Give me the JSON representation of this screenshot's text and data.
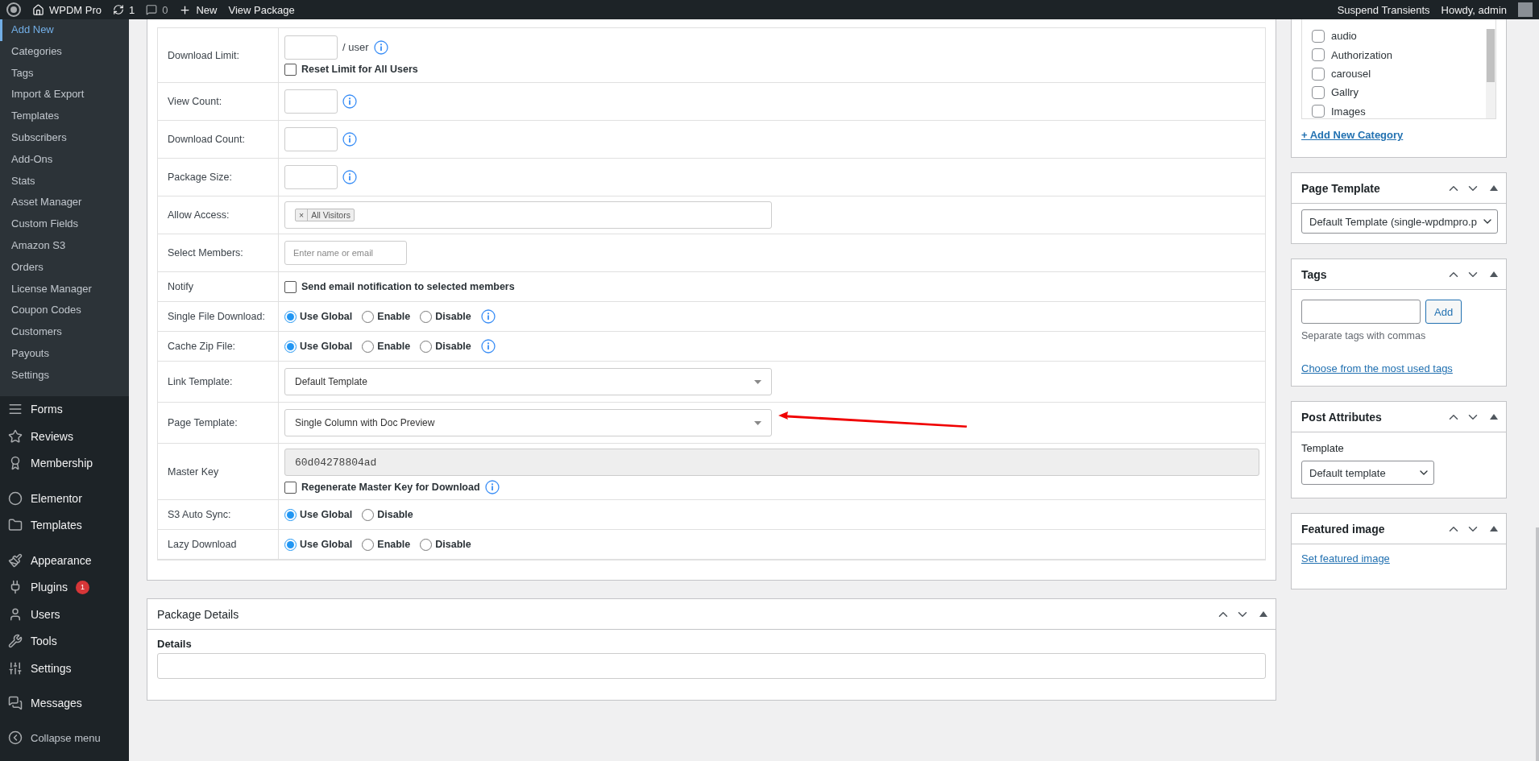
{
  "admin_bar": {
    "site": "WPDM Pro",
    "updates": "1",
    "comments": "0",
    "new": "New",
    "view": "View Package",
    "right": [
      "Suspend Transients",
      "Howdy, admin"
    ]
  },
  "sidebar": {
    "submenu": [
      {
        "label": "Add New",
        "selected": true
      },
      {
        "label": "Categories",
        "selected": false
      },
      {
        "label": "Tags",
        "selected": false
      },
      {
        "label": "Import & Export",
        "selected": false
      },
      {
        "label": "Templates",
        "selected": false
      },
      {
        "label": "Subscribers",
        "selected": false
      },
      {
        "label": "Add-Ons",
        "selected": false
      },
      {
        "label": "Stats",
        "selected": false
      },
      {
        "label": "Asset Manager",
        "selected": false
      },
      {
        "label": "Custom Fields",
        "selected": false
      },
      {
        "label": "Amazon S3",
        "selected": false
      },
      {
        "label": "Orders",
        "selected": false
      },
      {
        "label": "License Manager",
        "selected": false
      },
      {
        "label": "Coupon Codes",
        "selected": false
      },
      {
        "label": "Customers",
        "selected": false
      },
      {
        "label": "Payouts",
        "selected": false
      },
      {
        "label": "Settings",
        "selected": false
      }
    ],
    "groups": [
      [
        {
          "label": "Forms"
        },
        {
          "label": "Reviews"
        },
        {
          "label": "Membership"
        }
      ],
      [
        {
          "label": "Elementor"
        },
        {
          "label": "Templates"
        }
      ],
      [
        {
          "label": "Appearance"
        },
        {
          "label": "Plugins",
          "badge": "1"
        },
        {
          "label": "Users"
        },
        {
          "label": "Tools"
        },
        {
          "label": "Settings"
        }
      ],
      [
        {
          "label": "Messages"
        }
      ]
    ],
    "collapse": "Collapse menu"
  },
  "settings_rows": [
    {
      "kind": "limit",
      "label": "Download Limit:",
      "unit": "/ user",
      "info": true,
      "checkbox": {
        "label": "Reset Limit for All Users",
        "checked": false
      }
    },
    {
      "kind": "number",
      "label": "View Count:",
      "info": true
    },
    {
      "kind": "number",
      "label": "Download Count:",
      "info": true
    },
    {
      "kind": "number",
      "label": "Package Size:",
      "info": true
    },
    {
      "kind": "tags",
      "label": "Allow Access:",
      "tags": [
        {
          "remove": "×",
          "label": "All Visitors"
        }
      ]
    },
    {
      "kind": "text",
      "label": "Select Members:",
      "placeholder": "Enter name or email"
    },
    {
      "kind": "checkbox",
      "label": "Notify",
      "checkbox": {
        "label": "Send email notification to selected members",
        "checked": false
      }
    },
    {
      "kind": "radio",
      "label": "Single File Download:",
      "info": true,
      "options": [
        {
          "label": "Use Global",
          "selected": true
        },
        {
          "label": "Enable",
          "selected": false
        },
        {
          "label": "Disable",
          "selected": false
        }
      ]
    },
    {
      "kind": "radio",
      "label": "Cache Zip File:",
      "info": true,
      "options": [
        {
          "label": "Use Global",
          "selected": true
        },
        {
          "label": "Enable",
          "selected": false
        },
        {
          "label": "Disable",
          "selected": false
        }
      ]
    },
    {
      "kind": "select",
      "label": "Link Template:",
      "value": "Default Template"
    },
    {
      "kind": "select",
      "label": "Page Template:",
      "value": "Single Column with Doc Preview",
      "annotated": true
    },
    {
      "kind": "key",
      "label": "Master Key",
      "value": "60d04278804ad",
      "info": true,
      "checkbox": {
        "label": "Regenerate Master Key for Download",
        "checked": false
      }
    },
    {
      "kind": "radio",
      "label": "S3 Auto Sync:",
      "info": false,
      "options": [
        {
          "label": "Use Global",
          "selected": true
        },
        {
          "label": "Disable",
          "selected": false
        }
      ]
    },
    {
      "kind": "radio",
      "label": "Lazy Download",
      "info": false,
      "options": [
        {
          "label": "Use Global",
          "selected": true
        },
        {
          "label": "Enable",
          "selected": false
        },
        {
          "label": "Disable",
          "selected": false
        }
      ]
    }
  ],
  "package_details": {
    "title": "Package Details",
    "field_label": "Details"
  },
  "categories": {
    "items": [
      {
        "label": "audio",
        "checked": false
      },
      {
        "label": "Authorization",
        "checked": false
      },
      {
        "label": "carousel",
        "checked": false
      },
      {
        "label": "Gallry",
        "checked": false
      },
      {
        "label": "Images",
        "checked": false
      }
    ],
    "add_link": "+ Add New Category"
  },
  "page_template": {
    "title": "Page Template",
    "value": "Default Template (single-wpdmpro.p"
  },
  "tags": {
    "title": "Tags",
    "button": "Add",
    "hint": "Separate tags with commas",
    "link": "Choose from the most used tags"
  },
  "post_attributes": {
    "title": "Post Attributes",
    "field_label": "Template",
    "value": "Default template"
  },
  "featured_image": {
    "title": "Featured image",
    "link": "Set featured image"
  }
}
